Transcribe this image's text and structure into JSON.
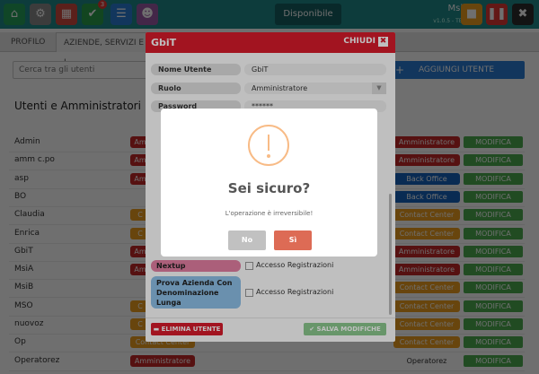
{
  "topbar": {
    "status": "Disponibile",
    "user": "MsiA",
    "version": "v1.0.5 - TEST",
    "notification_count": "3",
    "colors": {
      "bar": "#1f8a8c",
      "home": "#27a35c",
      "gear": "#8a8a8a",
      "calendar": "#d24b3e",
      "check": "#2aa04a",
      "list": "#2b7fd6",
      "users": "#9b5ba5",
      "pause": "#e53935",
      "lock": "#f0a020"
    }
  },
  "tabs": [
    {
      "label": "PROFILO"
    },
    {
      "label": "AZIENDE, SERVIZI E L"
    }
  ],
  "search": {
    "placeholder": "Cerca tra gli utenti"
  },
  "add_user": {
    "icon": "plus-icon",
    "label": "AGGIUNGI UTENTE"
  },
  "section_title": "Utenti e Amministratori",
  "users": [
    {
      "name": "Admin",
      "left_role": "Am",
      "right_role": "Amministratore",
      "edit": "MODIFICA"
    },
    {
      "name": "amm c.po",
      "left_role": "Am",
      "right_role": "Amministratore",
      "edit": "MODIFICA"
    },
    {
      "name": "asp",
      "left_role": "Am",
      "right_role": "Back Office",
      "edit": "MODIFICA"
    },
    {
      "name": "BO",
      "left_role": "",
      "right_role": "Back Office",
      "edit": "MODIFICA"
    },
    {
      "name": "Claudia",
      "left_role": "C",
      "right_role": "Contact Center",
      "edit": "MODIFICA"
    },
    {
      "name": "Enrica",
      "left_role": "C",
      "right_role": "Contact Center",
      "edit": "MODIFICA"
    },
    {
      "name": "GbiT",
      "left_role": "Am",
      "right_role": "Amministratore",
      "edit": "MODIFICA"
    },
    {
      "name": "MsiA",
      "left_role": "Am",
      "right_role": "Amministratore",
      "edit": "MODIFICA"
    },
    {
      "name": "MsiB",
      "left_role": "",
      "right_role": "Contact Center",
      "edit": "MODIFICA"
    },
    {
      "name": "MSO",
      "left_role": "C",
      "right_role": "Contact Center",
      "edit": "MODIFICA"
    },
    {
      "name": "nuovoz",
      "left_role": "C",
      "right_role": "Contact Center",
      "edit": "MODIFICA"
    },
    {
      "name": "Op",
      "left_role": "Contact Center",
      "right_role": "Contact Center",
      "edit": "MODIFICA"
    },
    {
      "name": "Operatorez",
      "left_role": "Amministratore",
      "right_role": "Operatorez",
      "edit": "MODIFICA"
    }
  ],
  "role_colors": {
    "Amministratore": "#c62828",
    "Back Office": "#1565c0",
    "Contact Center": "#f0a020",
    "edit": "#4caf50"
  },
  "edit_modal": {
    "title": "GbiT",
    "close_label": "CHIUDI",
    "fields": [
      {
        "label": "Nome Utente",
        "value": "GbiT"
      },
      {
        "label": "Ruolo",
        "value": "Amministratore"
      },
      {
        "label": "Password",
        "value": "******"
      }
    ],
    "companies": [
      {
        "label": "Nextup",
        "color": "#e57fa3",
        "checkbox": "Accesso Registrazioni"
      },
      {
        "label": "Prova Azienda Con Denominazione Lunga",
        "color": "#8ec0e8",
        "checkbox": "Accesso Registrazioni"
      }
    ],
    "delete_label": "ELIMINA UTENTE",
    "save_label": "SALVA MODIFICHE"
  },
  "confirm": {
    "title": "Sei sicuro?",
    "text": "L'operazione è irreversibile!",
    "no": "No",
    "yes": "Sì"
  }
}
